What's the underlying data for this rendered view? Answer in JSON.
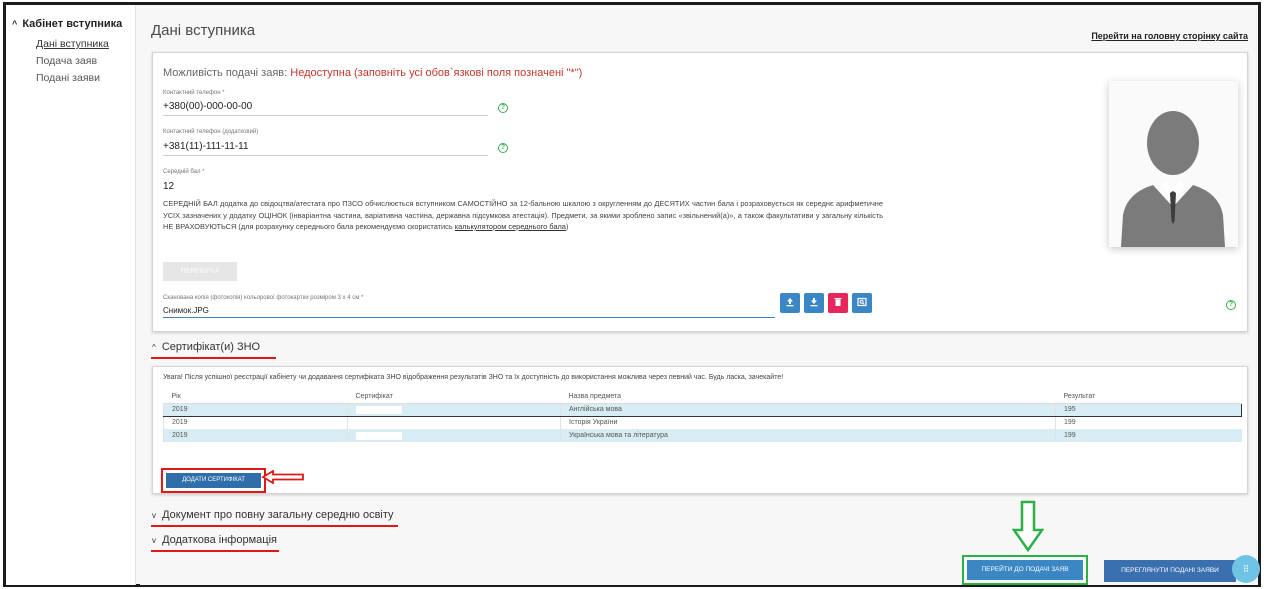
{
  "sidebar": {
    "header": "Кабінет вступника",
    "items": [
      {
        "label": "Дані вступника"
      },
      {
        "label": "Подача заяв"
      },
      {
        "label": "Подані заяви"
      }
    ]
  },
  "header": {
    "title": "Дані вступника",
    "home_link": "Перейти на головну сторінку сайта"
  },
  "applicant": {
    "availability_label": "Можливість подачі заяв:",
    "availability_status": "Недоступна (заповніть усі обов`язкові поля позначені \"*\")",
    "phone": {
      "label": "Контактний телефон *",
      "value": "+380(00)-000-00-00"
    },
    "phone_extra": {
      "label": "Контактний телефон (додатковий)",
      "value": "+381(11)-111-11-11"
    },
    "avg_score": {
      "label": "Середній бал *",
      "value": "12"
    },
    "avg_desc": "СЕРЕДНІЙ БАЛ додатка до свідоцтва/атестата про ПЗСО обчислюється вступником САМОСТІЙНО за 12-бальною шкалою з округленням до ДЕСЯТИХ частин бала і розраховується як середнє арифметичне УСІХ зазначених у додатку ОЦІНОК (інваріантна частина, варіативна частина, державна підсумкова атестація). Предмети, за якими зроблено запис «звільнений(а)», а також факультативи у загальну кількість НЕ ВРАХОВУЮТЬСЯ (для розрахунку середнього бала рекомендуємо скористатись",
    "avg_desc_link": "калькулятором середнього бала",
    "avg_desc_end": ")",
    "recalc_button": "ПЕРЕВІРКА",
    "photo": {
      "label": "Сканована копія (фотокопія) кольорової фотокартки розміром 3 x 4 см *",
      "value": "Снимок.JPG"
    }
  },
  "icons": {
    "upload": "upload-icon",
    "download": "download-icon",
    "delete": "trash-icon",
    "view": "view-icon",
    "help": "question-circle-icon",
    "avatar": "person-silhouette-icon"
  },
  "colors": {
    "accent_blue": "#3b86c5",
    "danger_pink": "#e8265e",
    "warn_red": "#c0392b",
    "highlight_red": "#e01818",
    "highlight_green": "#2bb04a",
    "row_blue": "#d7edf3"
  },
  "certificates": {
    "section_title": "Сертифікат(и) ЗНО",
    "notice": "Увага! Після успішної реєстрації кабінету чи додавання сертифіката ЗНО відображення результатів ЗНО та їх доступність до використання можлива через певний час. Будь ласка, зачекайте!",
    "columns": [
      "Рік",
      "Сертифікат",
      "Назва предмета",
      "Результат"
    ],
    "rows": [
      {
        "year": "2019",
        "cert": "",
        "subject": "Англійська мова",
        "result": "195"
      },
      {
        "year": "2019",
        "cert": "",
        "subject": "Історія України",
        "result": "199"
      },
      {
        "year": "2019",
        "cert": "",
        "subject": "Українська мова та література",
        "result": "199"
      }
    ],
    "add_button": "ДОДАТИ СЕРТИФІКАТ"
  },
  "sections": {
    "education_doc": "Документ про повну загальну середню освіту",
    "additional_info": "Додаткова інформація"
  },
  "actions": {
    "goto_applications": "ПЕРЕЙТИ ДО ПОДАЧІ ЗАЯВ",
    "view_applications": "ПЕРЕГЛЯНУТИ ПОДАНІ ЗАЯВИ"
  }
}
